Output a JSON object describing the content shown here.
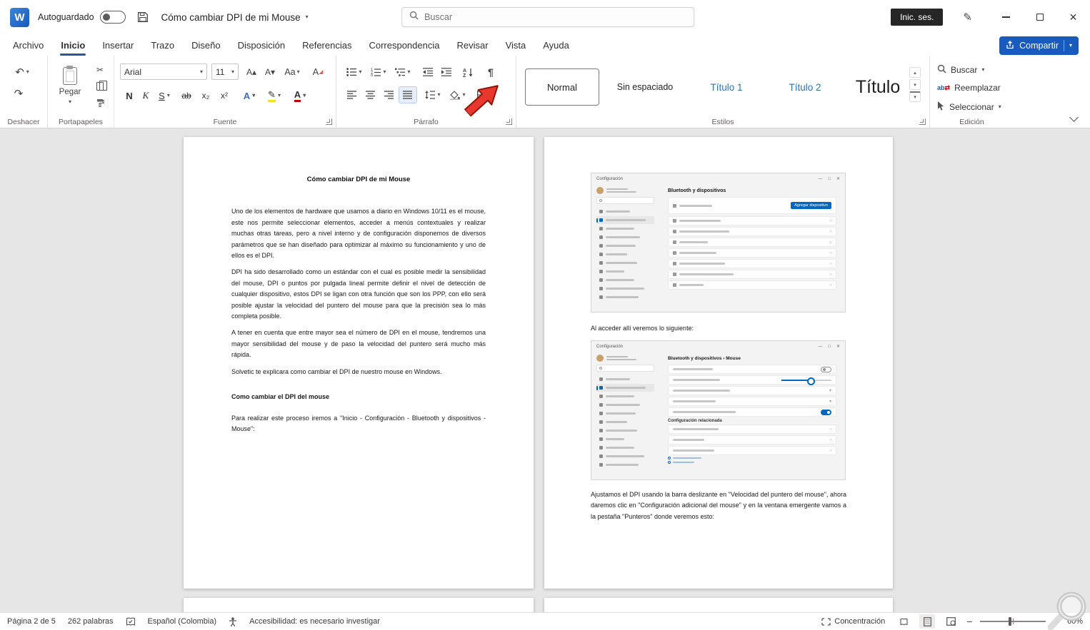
{
  "titlebar": {
    "autosave": "Autoguardado",
    "doc_title": "Cómo cambiar DPI de mi Mouse",
    "search_placeholder": "Buscar",
    "sign_in": "Inic. ses."
  },
  "tabs": [
    "Archivo",
    "Inicio",
    "Insertar",
    "Trazo",
    "Diseño",
    "Disposición",
    "Referencias",
    "Correspondencia",
    "Revisar",
    "Vista",
    "Ayuda"
  ],
  "share": "Compartir",
  "ribbon": {
    "undo_label": "Deshacer",
    "clipboard_label": "Portapapeles",
    "paste": "Pegar",
    "font_label": "Fuente",
    "font_name": "Arial",
    "font_size": "11",
    "paragraph_label": "Párrafo",
    "styles_label": "Estilos",
    "styles": [
      "Normal",
      "Sin espaciado",
      "Título 1",
      "Título 2",
      "Título"
    ],
    "editing_label": "Edición",
    "find": "Buscar",
    "replace": "Reemplazar",
    "select": "Seleccionar",
    "glyphs": {
      "bold": "N",
      "italic": "K",
      "underline": "S",
      "strike": "ab",
      "subscript": "x₂",
      "superscript": "x²",
      "effects": "A",
      "fontcolor": "A",
      "grow": "A^",
      "shrink": "Av",
      "case": "Aa"
    }
  },
  "doc": {
    "title": "Cómo cambiar DPI de mi Mouse",
    "p1": "Uno de los elementos de hardware que usamos a diario en Windows 10/11 es el mouse, este nos permite seleccionar elementos, acceder a menús contextuales y realizar muchas otras tareas, pero a nivel interno y de configuración disponemos de diversos parámetros que se han diseñado para optimizar al máximo su funcionamiento y uno de ellos es el DPI.",
    "p2": "DPI ha sido desarrollado como un estándar con el cual es posible medir la sensibilidad del mouse, DPI o puntos por pulgada lineal permite definir el nivel de detección de cualquier dispositivo, estos DPI se ligan con otra función que son los PPP, con ello será posible ajustar la velocidad del puntero del mouse para que la precisión sea lo más completa posible.",
    "p3": "A tener en cuenta que entre mayor sea el número de DPI en el mouse, tendremos una mayor sensibilidad del mouse y de paso la velocidad del puntero será mucho más rápida.",
    "p4": "Solvetic te explicara como cambiar el DPI de nuestro mouse en Windows.",
    "h2": "Como cambiar el DPI del mouse",
    "p5": "Para realizar este proceso iremos a \"Inicio - Configuración - Bluetooth y dispositivos - Mouse\":",
    "caption1": "Al acceder allí veremos lo siguiente:",
    "p6": "Ajustamos el DPI usando la barra deslizante en \"Velocidad del puntero del mouse\", ahora daremos clic en \"Configuración adicional del mouse\" y en la ventana emergente vamos a la pestaña \"Punteros\" donde veremos esto:"
  },
  "settings_shots": {
    "app_title": "Configuración",
    "shot1_heading": "Bluetooth y dispositivos",
    "add_button": "Agregar dispositivo",
    "shot2_heading": "Bluetooth y dispositivos  ›  Mouse",
    "related": "Configuración relacionada"
  },
  "statusbar": {
    "page": "Página 2 de 5",
    "words": "262 palabras",
    "language": "Español (Colombia)",
    "accessibility": "Accesibilidad: es necesario investigar",
    "focus": "Concentración",
    "zoom": "60%"
  }
}
